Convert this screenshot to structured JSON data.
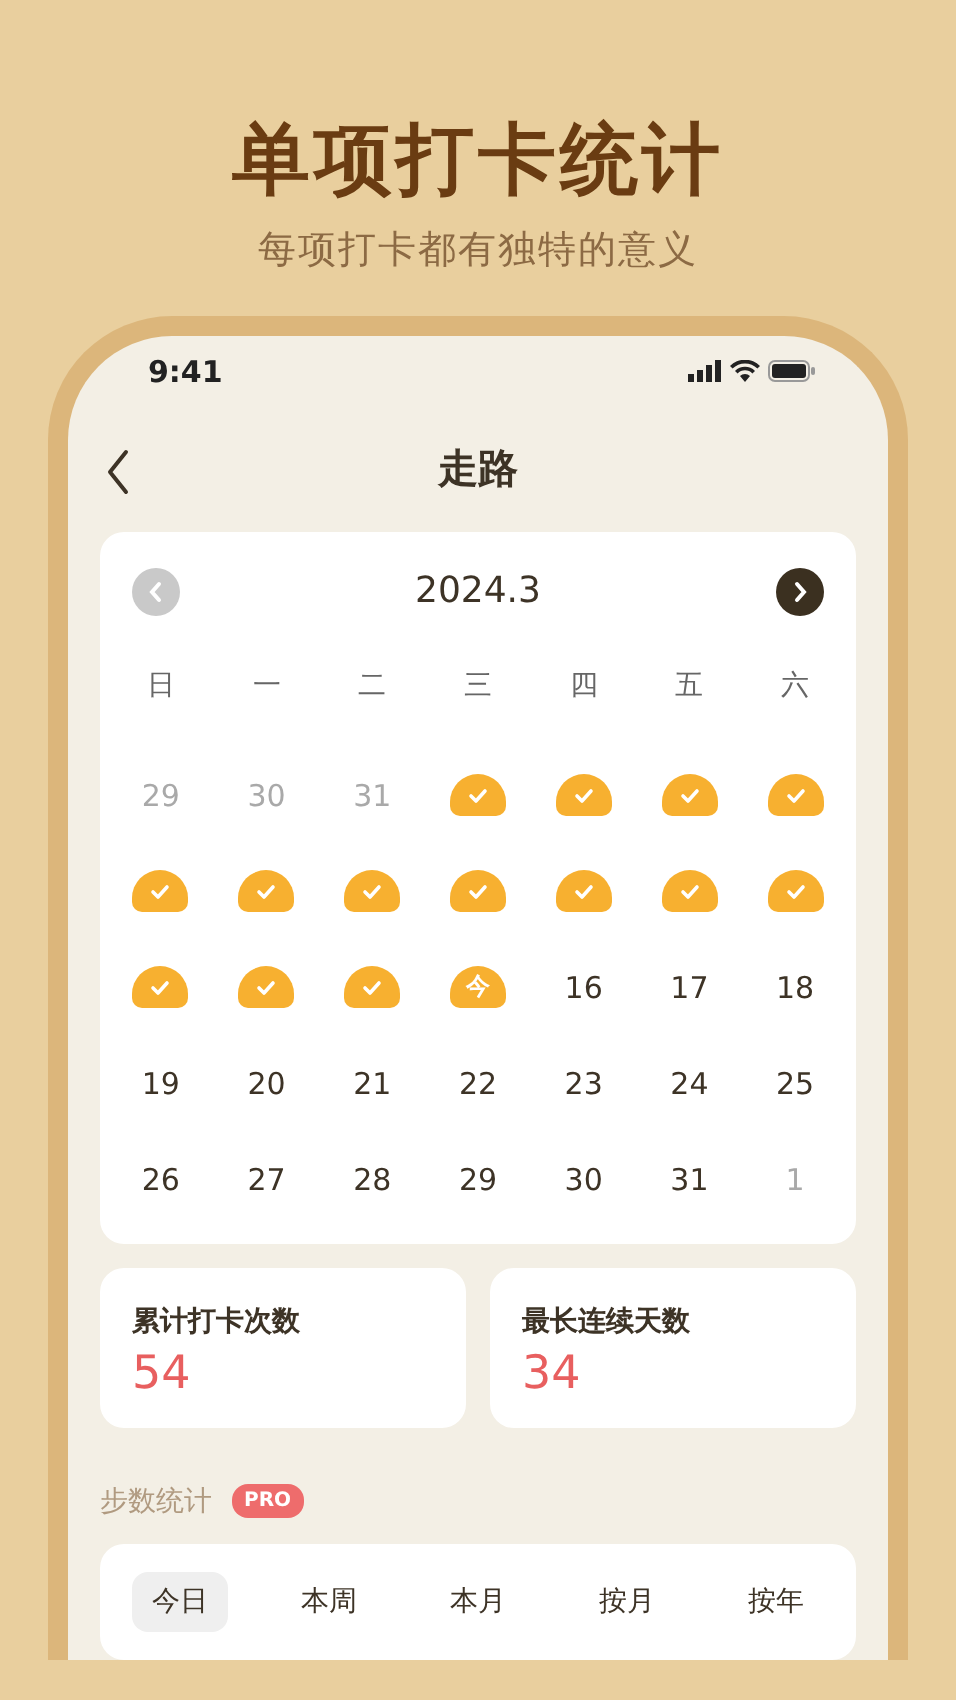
{
  "headline": "单项打卡统计",
  "subtitle": "每项打卡都有独特的意义",
  "status_bar": {
    "time": "9:41"
  },
  "nav": {
    "title": "走路"
  },
  "calendar": {
    "month": "2024.3",
    "prev_disabled": true,
    "next_disabled": false,
    "weekdays": [
      "日",
      "一",
      "二",
      "三",
      "四",
      "五",
      "六"
    ],
    "days": [
      {
        "kind": "muted",
        "label": "29"
      },
      {
        "kind": "muted",
        "label": "30"
      },
      {
        "kind": "muted",
        "label": "31"
      },
      {
        "kind": "checked"
      },
      {
        "kind": "checked"
      },
      {
        "kind": "checked"
      },
      {
        "kind": "checked"
      },
      {
        "kind": "checked"
      },
      {
        "kind": "checked"
      },
      {
        "kind": "checked"
      },
      {
        "kind": "checked"
      },
      {
        "kind": "checked"
      },
      {
        "kind": "checked"
      },
      {
        "kind": "checked"
      },
      {
        "kind": "checked"
      },
      {
        "kind": "checked"
      },
      {
        "kind": "checked"
      },
      {
        "kind": "today",
        "label": "今"
      },
      {
        "kind": "normal",
        "label": "16"
      },
      {
        "kind": "normal",
        "label": "17"
      },
      {
        "kind": "normal",
        "label": "18"
      },
      {
        "kind": "normal",
        "label": "19"
      },
      {
        "kind": "normal",
        "label": "20"
      },
      {
        "kind": "normal",
        "label": "21"
      },
      {
        "kind": "normal",
        "label": "22"
      },
      {
        "kind": "normal",
        "label": "23"
      },
      {
        "kind": "normal",
        "label": "24"
      },
      {
        "kind": "normal",
        "label": "25"
      },
      {
        "kind": "normal",
        "label": "26"
      },
      {
        "kind": "normal",
        "label": "27"
      },
      {
        "kind": "normal",
        "label": "28"
      },
      {
        "kind": "normal",
        "label": "29"
      },
      {
        "kind": "normal",
        "label": "30"
      },
      {
        "kind": "normal",
        "label": "31"
      },
      {
        "kind": "muted",
        "label": "1"
      }
    ]
  },
  "stats": [
    {
      "label": "累计打卡次数",
      "value": "54"
    },
    {
      "label": "最长连续天数",
      "value": "34"
    }
  ],
  "section": {
    "title": "步数统计",
    "badge": "PRO"
  },
  "period_tabs": [
    {
      "label": "今日",
      "selected": true
    },
    {
      "label": "本周",
      "selected": false
    },
    {
      "label": "本月",
      "selected": false
    },
    {
      "label": "按月",
      "selected": false
    },
    {
      "label": "按年",
      "selected": false
    }
  ]
}
